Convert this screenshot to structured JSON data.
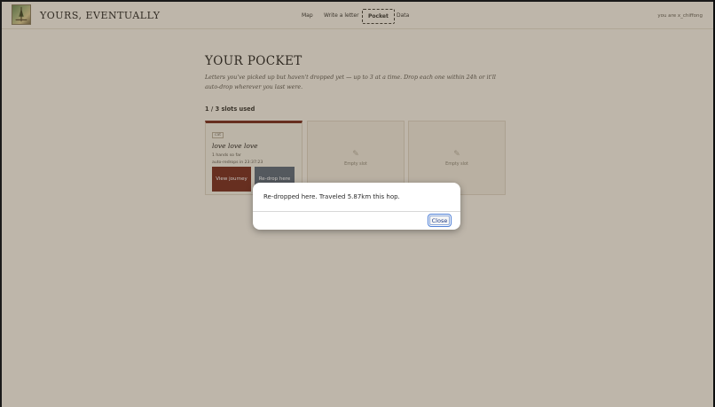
{
  "app": {
    "brand": "YOURS, EVENTUALLY",
    "user_label": "you are x_chiffong"
  },
  "nav": {
    "items": [
      {
        "label": "Map"
      },
      {
        "label": "Write a letter"
      },
      {
        "label": "Pocket",
        "active": true
      },
      {
        "label": "Data"
      }
    ]
  },
  "page": {
    "title": "YOUR POCKET",
    "subtitle": "Letters you've picked up but haven't dropped yet — up to 3 at a time. Drop each one within 24h or it'll auto-drop wherever you last were.",
    "slots_used": "1 / 3 slots used"
  },
  "slots": [
    {
      "badge": "cat",
      "title": "love love love",
      "hands": "1 hands so far",
      "redrop": "auto-redrops in 23:37:23",
      "view_label": "View journey",
      "redrop_label": "Re-drop here"
    },
    {
      "empty_label": "Empty slot"
    },
    {
      "empty_label": "Empty slot"
    }
  ],
  "dialog": {
    "message": "Re-dropped here. Traveled 5.87km this hop.",
    "close_label": "Close"
  },
  "colors": {
    "background": "#f6efe4",
    "accent": "#7a2e1f",
    "secondary_button": "#5f6a78"
  }
}
